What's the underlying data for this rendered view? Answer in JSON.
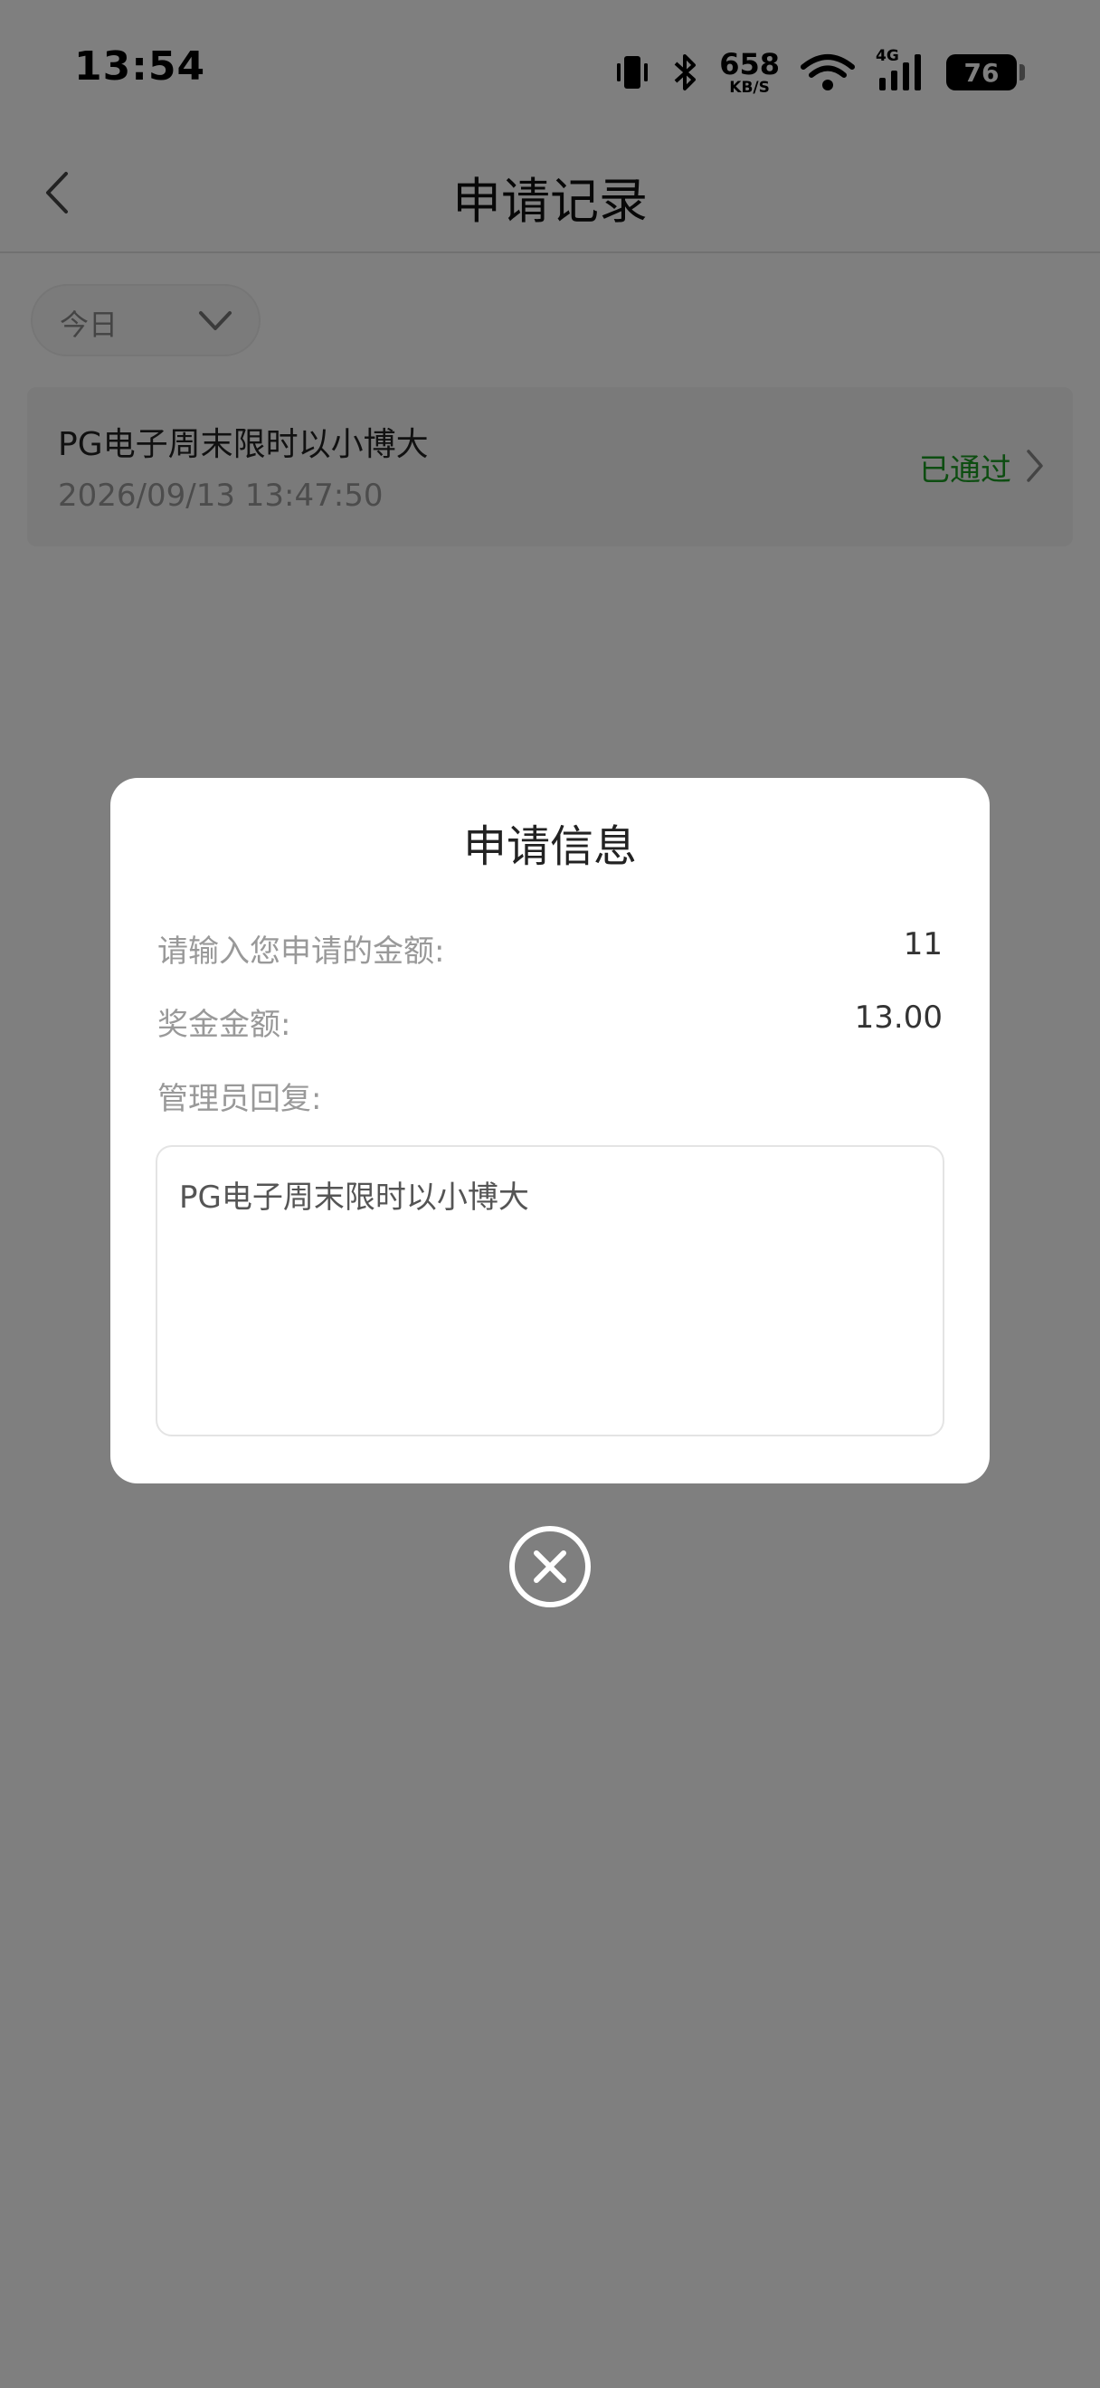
{
  "status_bar": {
    "time": "13:54",
    "network_speed": "658",
    "network_speed_unit": "KB/S",
    "network_type": "4G",
    "battery_level": "76",
    "icons": [
      "vibrate-icon",
      "bluetooth-icon",
      "wifi-icon",
      "signal-icon",
      "battery-icon"
    ]
  },
  "header": {
    "title": "申请记录",
    "back_icon": "chevron-left-icon"
  },
  "filter": {
    "selected": "今日",
    "icon": "chevron-down-icon"
  },
  "records": [
    {
      "title": "PG电子周末限时以小博大",
      "time": "2026/09/13 13:47:50",
      "status": "已通过",
      "status_color": "#1a9a22"
    }
  ],
  "modal": {
    "title": "申请信息",
    "amount_label": "请输入您申请的金额:",
    "amount_value": "11",
    "bonus_label": "奖金金额:",
    "bonus_value": "13.00",
    "reply_label": "管理员回复:",
    "reply_text": "PG电子周末限时以小博大",
    "close_icon": "close-circle-icon"
  }
}
